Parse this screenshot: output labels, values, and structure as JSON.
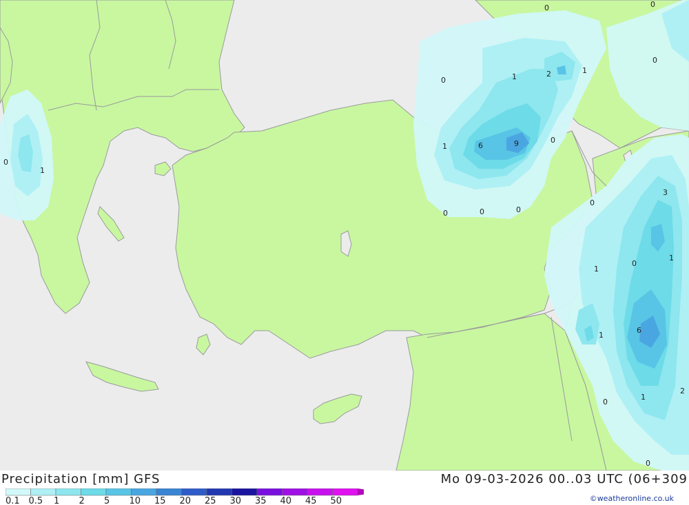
{
  "map": {
    "title": "Precipitation [mm] GFS",
    "datetime": "Mo 09-03-2026 00..03 UTC (06+309",
    "credit": "©weatheronline.co.uk",
    "colors": {
      "sea": "#ececec",
      "land": "#c8f7a0",
      "border": "#9a9a9a"
    },
    "value_labels": [
      "0",
      "1",
      "2",
      "1",
      "0",
      "0",
      "1",
      "6",
      "9",
      "0",
      "0",
      "0",
      "0",
      "0",
      "3",
      "1",
      "0",
      "1",
      "1",
      "6",
      "0",
      "1",
      "2",
      "0",
      "0",
      "1",
      "0"
    ],
    "legend": {
      "labels": [
        "0.1",
        "0.5",
        "1",
        "2",
        "5",
        "10",
        "15",
        "20",
        "25",
        "30",
        "35",
        "40",
        "45",
        "50"
      ],
      "colors": [
        "#d2f8fa",
        "#aff0f5",
        "#8ee6ee",
        "#6ddbe8",
        "#58c4e6",
        "#4aa6e0",
        "#3a84d4",
        "#2e5cc8",
        "#2238b0",
        "#1a14a0",
        "#7a10e0",
        "#a010e6",
        "#c810ee",
        "#e010f0",
        "#b00ab8"
      ]
    }
  }
}
